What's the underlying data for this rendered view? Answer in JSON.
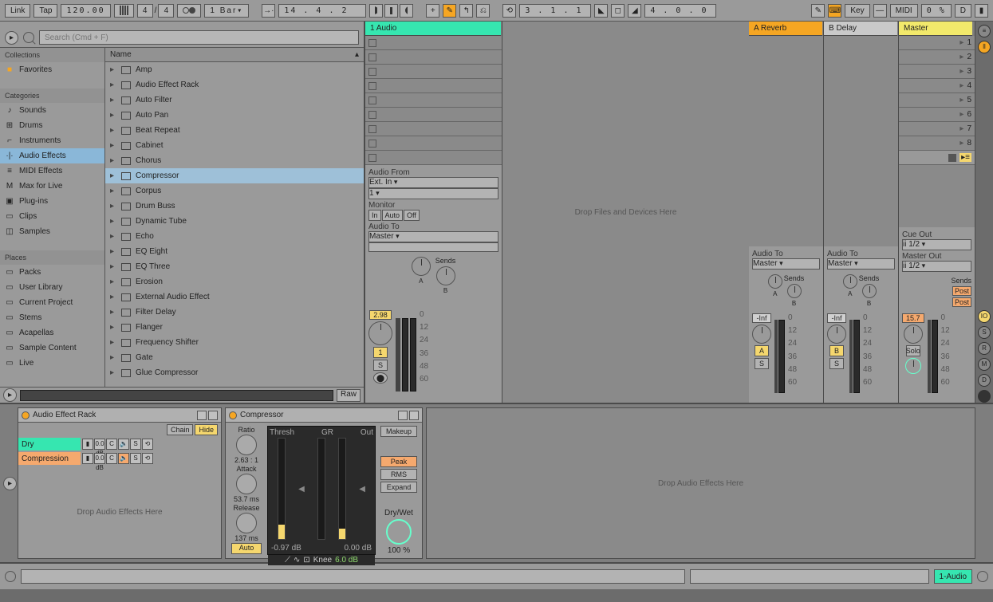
{
  "toolbar": {
    "link": "Link",
    "tap": "Tap",
    "tempo": "120.00",
    "sig_num": "4",
    "sig_den": "4",
    "bar": "1 Bar",
    "position": "14 .  4 .  2",
    "loop_pos": "  3 .  1 .  1",
    "loop_len": "  4 .  0 .  0",
    "key": "Key",
    "midi": "MIDI",
    "cpu": "0 %",
    "d": "D"
  },
  "browser": {
    "search_ph": "Search (Cmd + F)",
    "collections_hdr": "Collections",
    "favorites": "Favorites",
    "categories_hdr": "Categories",
    "categories": [
      "Sounds",
      "Drums",
      "Instruments",
      "Audio Effects",
      "MIDI Effects",
      "Max for Live",
      "Plug-ins",
      "Clips",
      "Samples"
    ],
    "cat_sel": 3,
    "places_hdr": "Places",
    "places": [
      "Packs",
      "User Library",
      "Current Project",
      "Stems",
      "Acapellas",
      "Sample Content",
      "Live"
    ],
    "name_hdr": "Name",
    "items": [
      "Amp",
      "Audio Effect Rack",
      "Auto Filter",
      "Auto Pan",
      "Beat Repeat",
      "Cabinet",
      "Chorus",
      "Compressor",
      "Corpus",
      "Drum Buss",
      "Dynamic Tube",
      "Echo",
      "EQ Eight",
      "EQ Three",
      "Erosion",
      "External Audio Effect",
      "Filter Delay",
      "Flanger",
      "Frequency Shifter",
      "Gate",
      "Glue Compressor"
    ],
    "item_sel": 7,
    "raw": "Raw"
  },
  "session": {
    "audio_track": "1 Audio",
    "reverb": "A Reverb",
    "delay": "B Delay",
    "master": "Master",
    "drop": "Drop Files and Devices Here",
    "audio_from": "Audio From",
    "ext_in": "Ext. In",
    "ch": "1",
    "monitor": "Monitor",
    "in": "In",
    "auto": "Auto",
    "off": "Off",
    "audio_to": "Audio To",
    "master_dest": "Master",
    "cue_out": "Cue Out",
    "out12": "ii 1/2",
    "master_out": "Master Out",
    "sends": "Sends",
    "vol_audio": "2.98",
    "vol_a": "-Inf",
    "vol_b": "-Inf",
    "vol_master": "15.7",
    "scale": [
      "0",
      "12",
      "24",
      "36",
      "48",
      "60"
    ],
    "tn_1": "1",
    "tn_a": "A",
    "tn_b": "B",
    "s": "S",
    "solo": "Solo",
    "post": "Post",
    "scene_count": 8
  },
  "devices": {
    "rack_title": "Audio Effect Rack",
    "chain": "Chain",
    "hide": "Hide",
    "dry": "Dry",
    "comp": "Compression",
    "db": "0.0 dB",
    "c": "C",
    "s": "S",
    "rack_drop": "Drop Audio Effects Here",
    "comp_title": "Compressor",
    "ratio": "Ratio",
    "ratio_v": "2.63 : 1",
    "attack": "Attack",
    "attack_v": "53.7 ms",
    "release": "Release",
    "release_v": "137 ms",
    "auto": "Auto",
    "thresh": "Thresh",
    "gr": "GR",
    "out": "Out",
    "thresh_v": "-0.97 dB",
    "out_v": "0.00 dB",
    "knee_lbl": "Knee",
    "knee_v": "6.0 dB",
    "makeup": "Makeup",
    "peak": "Peak",
    "rms": "RMS",
    "expand": "Expand",
    "drywet": "Dry/Wet",
    "drywet_v": "100 %",
    "main_drop": "Drop Audio Effects Here"
  },
  "bottom": {
    "track": "1-Audio"
  }
}
